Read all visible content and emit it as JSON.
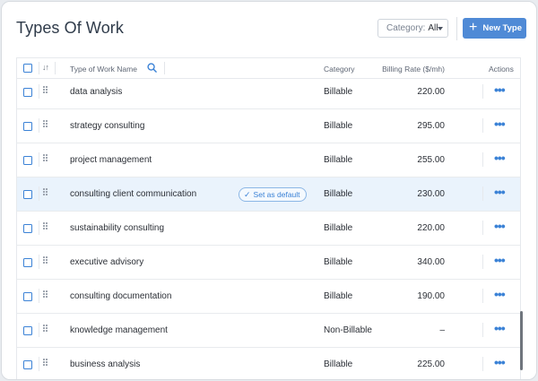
{
  "header": {
    "title": "Types Of Work",
    "category_label": "Category:",
    "category_value": "All",
    "new_button_label": "New Type"
  },
  "table": {
    "columns": {
      "name": "Type of Work Name",
      "category": "Category",
      "rate": "Billing Rate ($/mh)",
      "actions": "Actions"
    },
    "set_default_label": "Set as default",
    "more_glyph": "•••",
    "rows": [
      {
        "name": "data analysis",
        "category": "Billable",
        "rate": "220.00"
      },
      {
        "name": "strategy consulting",
        "category": "Billable",
        "rate": "295.00"
      },
      {
        "name": "project management",
        "category": "Billable",
        "rate": "255.00"
      },
      {
        "name": "consulting client communication",
        "category": "Billable",
        "rate": "230.00"
      },
      {
        "name": "sustainability consulting",
        "category": "Billable",
        "rate": "220.00"
      },
      {
        "name": "executive advisory",
        "category": "Billable",
        "rate": "340.00"
      },
      {
        "name": "consulting documentation",
        "category": "Billable",
        "rate": "190.00"
      },
      {
        "name": "knowledge management",
        "category": "Non-Billable",
        "rate": "–"
      },
      {
        "name": "business analysis",
        "category": "Billable",
        "rate": "225.00"
      }
    ]
  },
  "colors": {
    "accent": "#3b82d6",
    "button": "#4f8ad6",
    "highlight_row": "#eaf3fc"
  }
}
